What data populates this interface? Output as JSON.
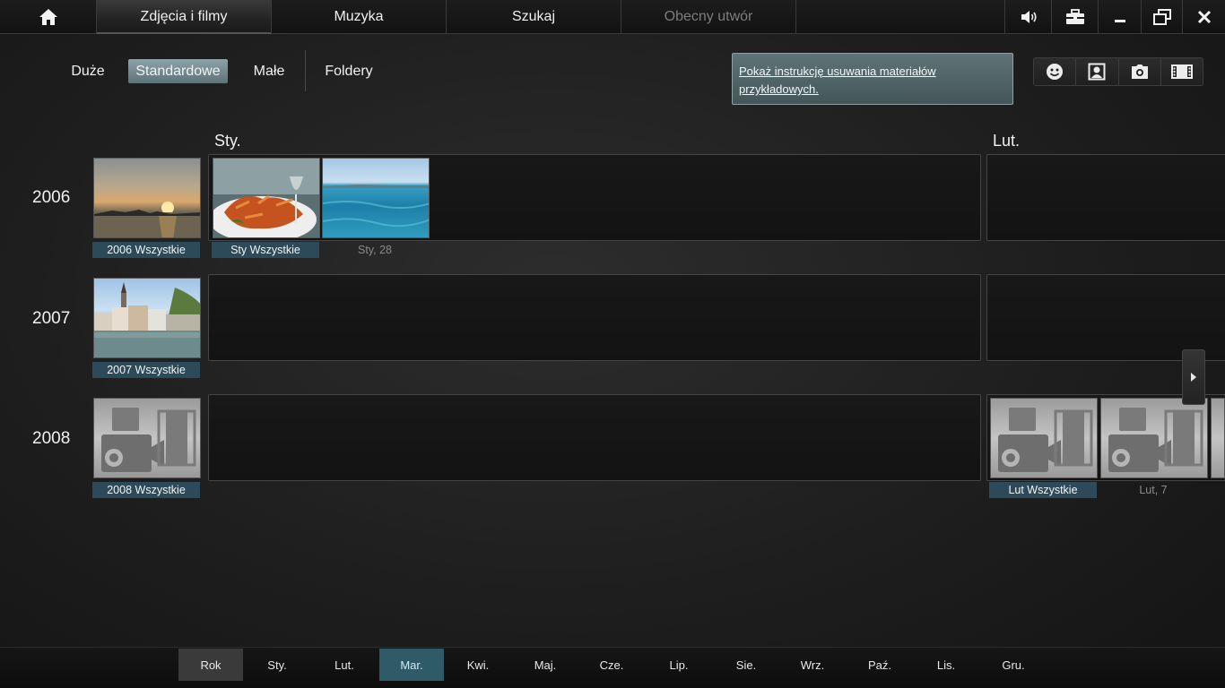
{
  "nav": {
    "home_icon": "home-icon",
    "tabs": [
      {
        "label": "Zdjęcia i filmy"
      },
      {
        "label": "Muzyka"
      },
      {
        "label": "Szukaj"
      },
      {
        "label": "Obecny utwór"
      }
    ],
    "icons": [
      "volume-icon",
      "toolbox-icon",
      "minimize-icon",
      "restore-icon",
      "close-icon"
    ]
  },
  "view_modes": {
    "items": [
      "Duże",
      "Standardowe",
      "Małe",
      "Foldery"
    ],
    "selected": "Standardowe"
  },
  "notice": "Pokaż instrukcję usuwania materiałów przykładowych.",
  "filters": [
    "face-icon",
    "portrait-icon",
    "camera-icon",
    "film-icon"
  ],
  "months_header": [
    "Sty.",
    "Lut."
  ],
  "years": [
    {
      "year": "2006",
      "all_label": "2006 Wszystkie",
      "month_all_label": "Sty Wszystkie",
      "date_label": "Sty, 28"
    },
    {
      "year": "2007",
      "all_label": "2007 Wszystkie"
    },
    {
      "year": "2008",
      "all_label": "2008 Wszystkie",
      "feb_all_label": "Lut Wszystkie",
      "feb_date_label": "Lut, 7"
    }
  ],
  "bottom_months": [
    "Rok",
    "Sty.",
    "Lut.",
    "Mar.",
    "Kwi.",
    "Maj.",
    "Cze.",
    "Lip.",
    "Sie.",
    "Wrz.",
    "Paź.",
    "Lis.",
    "Gru."
  ],
  "bottom_selected": "Mar.",
  "colors": {
    "accent": "#2f5a68",
    "highlight_label": "#2c4a5a",
    "notice_bg": "#5f7478"
  }
}
